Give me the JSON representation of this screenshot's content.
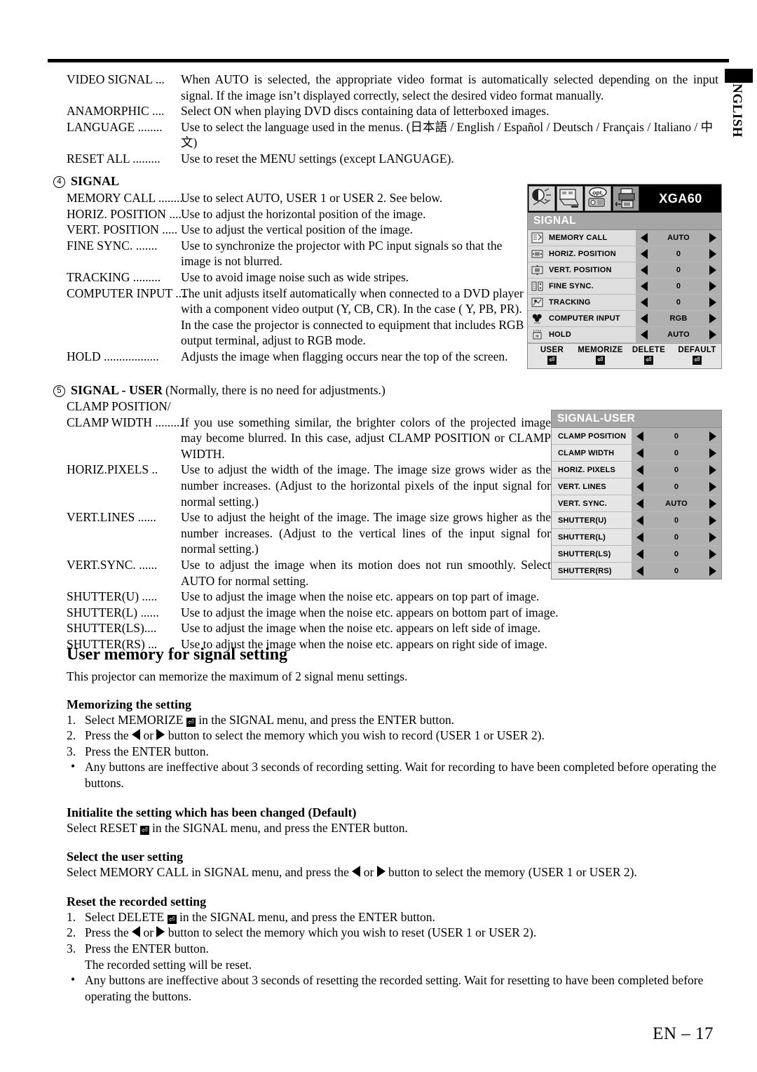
{
  "page": {
    "footer": "EN – 17",
    "side_tab": "ENGLISH"
  },
  "top_definitions": [
    {
      "term": "VIDEO SIGNAL ...",
      "desc": "When AUTO is selected, the appropriate video format is automatically selected depending on the input signal. If the image isn’t displayed correctly, select the desired video format manually."
    },
    {
      "term": "ANAMORPHIC ....",
      "desc": "Select ON when playing DVD discs containing data of letterboxed images."
    },
    {
      "term": "LANGUAGE ........",
      "desc": "Use to select the language used in the menus. (日本語 / English / Español / Deutsch / Français / Italiano / 中文)"
    },
    {
      "term": "RESET ALL .........",
      "desc": "Use to reset the MENU settings (except LANGUAGE)."
    }
  ],
  "signal_section": {
    "number": "4",
    "title": "SIGNAL",
    "items": [
      {
        "term": "MEMORY CALL ........",
        "desc": "Use to select AUTO, USER 1 or USER 2. See below."
      },
      {
        "term": "HORIZ. POSITION ....",
        "desc": "Use to adjust the horizontal position of the image."
      },
      {
        "term": "VERT. POSITION .....",
        "desc": "Use to adjust the vertical position of the image."
      },
      {
        "term": "FINE SYNC. .......",
        "desc": "Use to synchronize the projector with PC input signals so that the image is not blurred."
      },
      {
        "term": "TRACKING .........",
        "desc": "Use to avoid image noise such as wide stripes."
      },
      {
        "term": "COMPUTER INPUT ....",
        "desc": "The unit adjusts itself automatically when connected to a DVD player with a component video output (Y, CB, CR). In the case ( Y, PB, PR). In the case the projector is connected to equipment that includes RGB output terminal, adjust to RGB mode."
      },
      {
        "term": "HOLD ..................",
        "desc": "Adjusts the image when flagging occurs near the top of the screen."
      }
    ]
  },
  "signal_user_section": {
    "number": "5",
    "title": "SIGNAL  - USER",
    "title_note": "(Normally, there is no need for adjustments.)",
    "clamp_first_line": "CLAMP POSITION/",
    "items": [
      {
        "term": "CLAMP WIDTH .........",
        "desc": "If you use something similar, the brighter colors of the projected image may become blurred. In this case, adjust CLAMP POSITION or CLAMP WIDTH."
      },
      {
        "term": "HORIZ.PIXELS ..",
        "desc": "Use to adjust the width of the image.  The image size grows wider as the number increases.  (Adjust to the horizontal pixels of the input signal for normal setting.)"
      },
      {
        "term": "VERT.LINES ......",
        "desc": "Use to adjust the height of the image.  The image size grows higher as the number increases.  (Adjust to the vertical lines of the input signal for normal setting.)"
      },
      {
        "term": "VERT.SYNC. ......",
        "desc": "Use to adjust the image when its motion does not run smoothly.  Select AUTO for normal setting."
      },
      {
        "term": "SHUTTER(U) .....",
        "desc": "Use to adjust the image when the noise etc. appears on top part of image."
      },
      {
        "term": "SHUTTER(L) ......",
        "desc": "Use to adjust the image when the noise etc. appears on bottom part of image."
      },
      {
        "term": "SHUTTER(LS)....",
        "desc": "Use to adjust the image when the noise etc. appears on left side of image."
      },
      {
        "term": "SHUTTER(RS) ...",
        "desc": "Use to adjust the image when the noise etc. appears on right side of image."
      }
    ]
  },
  "user_memory": {
    "heading": "User memory for signal setting",
    "intro": "This projector can memorize the maximum of 2 signal menu settings.",
    "memorizing": {
      "heading": "Memorizing the setting",
      "step1_a": "Select MEMORIZE",
      "step1_b": "in the SIGNAL menu, and press the ENTER button.",
      "step2_a": "Press the",
      "step2_or": "or",
      "step2_b": "button to select the memory which you wish to record (USER 1 or USER 2).",
      "step3": "Press the ENTER button.",
      "bullet": "Any buttons are ineffective about 3 seconds of recording setting.  Wait for recording to have been completed before operating the buttons."
    },
    "initialize": {
      "heading": "Initialite the setting which has been changed (Default)",
      "text_a": "Select RESET",
      "text_b": "in the SIGNAL menu, and press the ENTER button."
    },
    "select_user": {
      "heading": "Select the user setting",
      "text_a": "Select MEMORY CALL in SIGNAL menu, and press the",
      "text_or": "or",
      "text_b": "button to select the memory (USER 1 or USER 2)."
    },
    "reset_recorded": {
      "heading": "Reset the recorded setting",
      "step1_a": "Select DELETE",
      "step1_b": "in the SIGNAL menu, and press the ENTER button.",
      "step2_a": "Press the",
      "step2_or": "or",
      "step2_b": "button to select the memory which you wish to reset (USER 1 or USER 2).",
      "step3": "Press the ENTER button.",
      "step3_sub": "The recorded setting will be reset.",
      "bullet": "Any buttons are ineffective about 3 seconds of resetting the recorded setting.  Wait for resetting to have been completed before operating the buttons."
    }
  },
  "osd_signal": {
    "signal_name": "XGA60",
    "header": "SIGNAL",
    "tabs": [
      {
        "icon": "image-contrast-icon",
        "selected": false
      },
      {
        "icon": "screen-picture-icon",
        "selected": false
      },
      {
        "icon": "options-opt-icon",
        "selected": false
      },
      {
        "icon": "signal-input-icon",
        "selected": true
      }
    ],
    "rows": [
      {
        "icon": "memory-call-icon",
        "label": "MEMORY CALL",
        "value": "AUTO"
      },
      {
        "icon": "horiz-position-icon",
        "label": "HORIZ. POSITION",
        "value": "0"
      },
      {
        "icon": "vert-position-icon",
        "label": "VERT. POSITION",
        "value": "0"
      },
      {
        "icon": "fine-sync-icon",
        "label": "FINE SYNC.",
        "value": "0"
      },
      {
        "icon": "tracking-icon",
        "label": "TRACKING",
        "value": "0"
      },
      {
        "icon": "computer-input-icon",
        "label": "COMPUTER INPUT",
        "value": "RGB"
      },
      {
        "icon": "hold-icon",
        "label": "HOLD",
        "value": "AUTO"
      }
    ],
    "footer_buttons": [
      {
        "label": "USER",
        "glyph": "⏎"
      },
      {
        "label": "MEMORIZE",
        "glyph": "⏎"
      },
      {
        "label": "DELETE",
        "glyph": "⏎"
      },
      {
        "label": "DEFAULT",
        "glyph": "⏎"
      }
    ]
  },
  "osd_signal_user": {
    "header": "SIGNAL-USER",
    "rows": [
      {
        "label": "CLAMP POSITION",
        "value": "0"
      },
      {
        "label": "CLAMP WIDTH",
        "value": "0"
      },
      {
        "label": "HORIZ. PIXELS",
        "value": "0"
      },
      {
        "label": "VERT. LINES",
        "value": "0"
      },
      {
        "label": "VERT. SYNC.",
        "value": "AUTO"
      },
      {
        "label": "SHUTTER(U)",
        "value": "0"
      },
      {
        "label": "SHUTTER(L)",
        "value": "0"
      },
      {
        "label": "SHUTTER(LS)",
        "value": "0"
      },
      {
        "label": "SHUTTER(RS)",
        "value": "0"
      }
    ]
  },
  "colors": {
    "osd_header_bg": "#a6a6a6",
    "osd_value_bg": "#b0b0b0",
    "osd_label_bg": "#dedede",
    "osd_titlebar_bg": "#000000"
  }
}
